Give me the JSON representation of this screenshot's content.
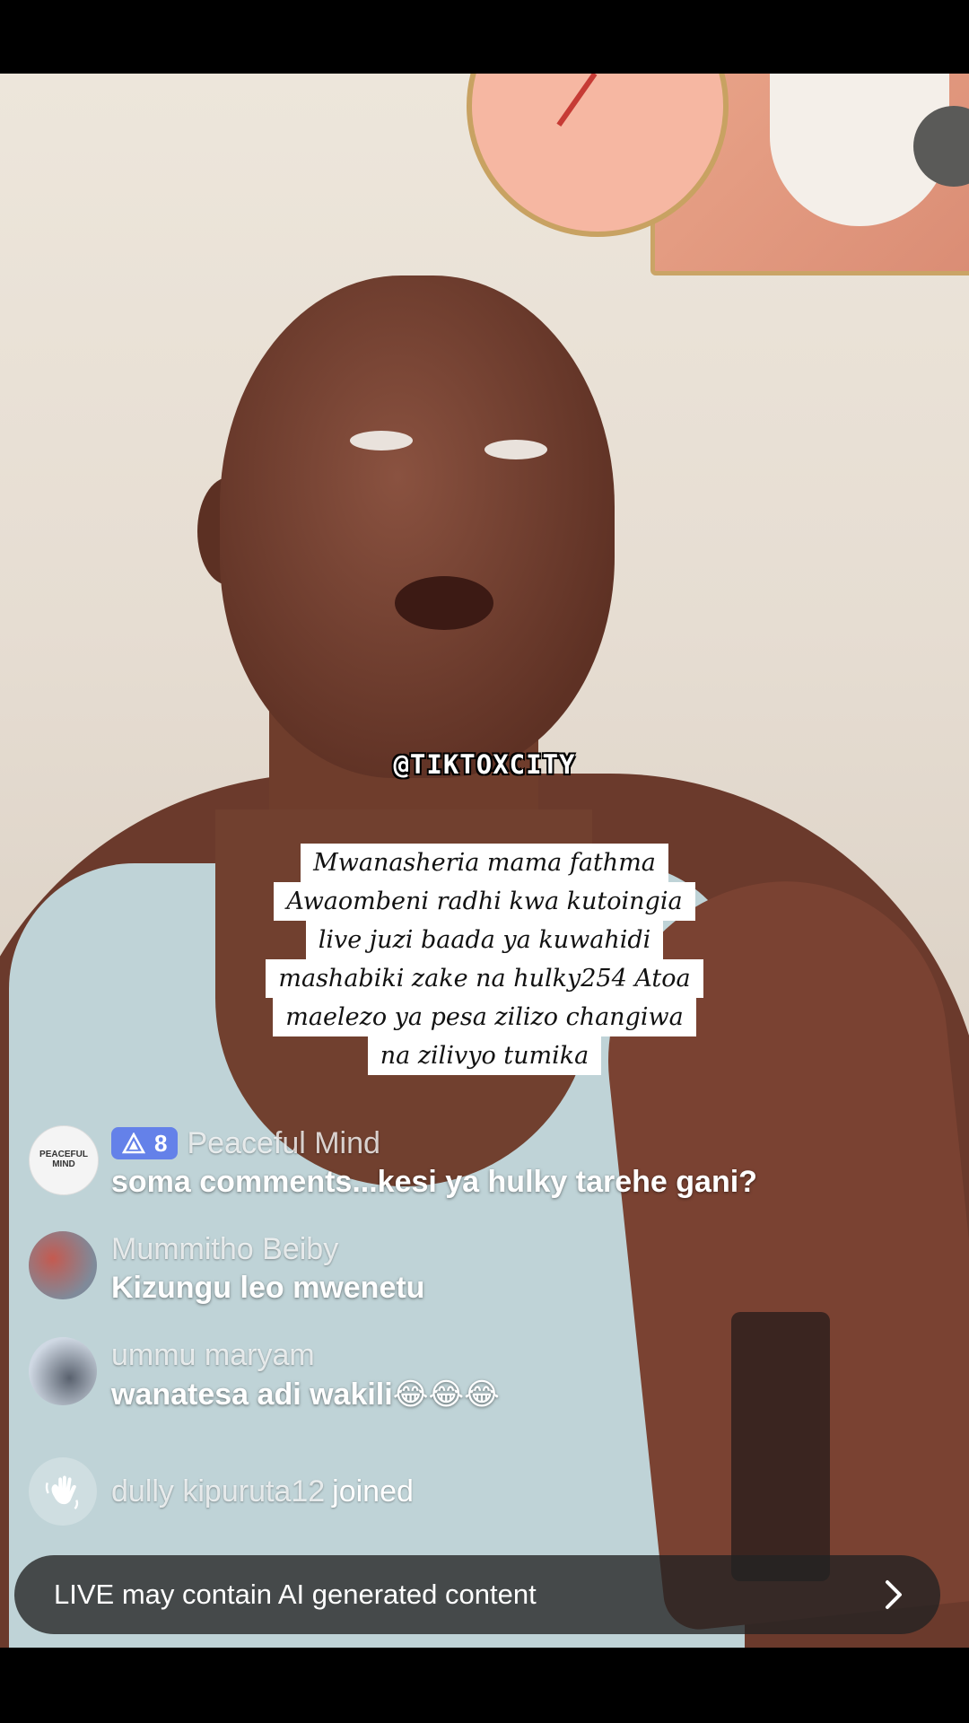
{
  "watermark": "@TIKTOXCITY",
  "caption": {
    "lines": [
      "Mwanasheria mama fathma",
      "Awaombeni radhi kwa kutoingia",
      "live juzi baada ya kuwahidi",
      "mashabiki zake na hulky254  Atoa",
      "maelezo  ya pesa zilizo changiwa",
      "na zilivyo tumika"
    ]
  },
  "comments": [
    {
      "avatar_text": "PEACEFUL MIND",
      "badge_level": "8",
      "username": "Peaceful Mind",
      "text": "soma comments...kesi ya hulky tarehe gani?"
    },
    {
      "username": "Mummitho Beiby",
      "text": "Kizungu leo mwenetu"
    },
    {
      "username": "ummu maryam",
      "text": "wanatesa adi wakili😂😂😂"
    }
  ],
  "join_event": {
    "username": "dully kipuruta12",
    "action": "joined"
  },
  "ai_notice": {
    "text": "LIVE may contain AI generated content"
  },
  "icons": {
    "badge": "level-triangle-icon",
    "join": "wave-hand-icon",
    "notice": "chevron-right-icon"
  }
}
